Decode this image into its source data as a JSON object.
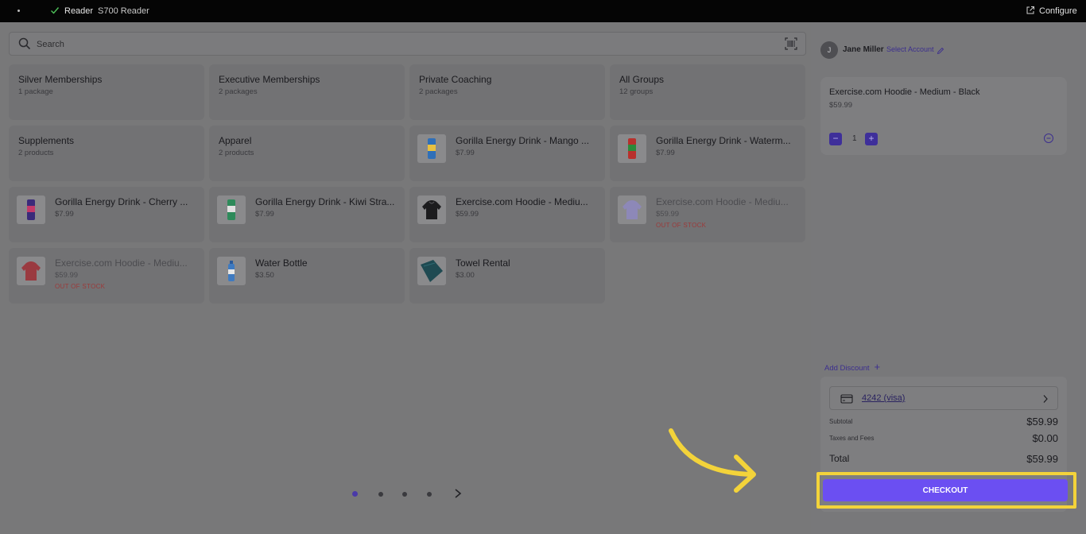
{
  "topbar": {
    "reader_label": "Reader",
    "device_label": "S700 Reader",
    "configure_label": "Configure"
  },
  "search": {
    "placeholder": "Search"
  },
  "categories": [
    {
      "name": "Silver Memberships",
      "sub": "1 package"
    },
    {
      "name": "Executive Memberships",
      "sub": "2 packages"
    },
    {
      "name": "Private Coaching",
      "sub": "2 packages"
    },
    {
      "name": "All Groups",
      "sub": "12 groups"
    },
    {
      "name": "Supplements",
      "sub": "2 products"
    },
    {
      "name": "Apparel",
      "sub": "2 products"
    }
  ],
  "products": [
    {
      "name": "Gorilla Energy Drink - Mango ...",
      "price": "$7.99",
      "thumb": "can-blue",
      "status": ""
    },
    {
      "name": "Gorilla Energy Drink - Waterm...",
      "price": "$7.99",
      "thumb": "can-red",
      "status": ""
    },
    {
      "name": "Gorilla Energy Drink - Cherry ...",
      "price": "$7.99",
      "thumb": "can-purple",
      "status": ""
    },
    {
      "name": "Gorilla Energy Drink - Kiwi Stra...",
      "price": "$7.99",
      "thumb": "can-green",
      "status": ""
    },
    {
      "name": "Exercise.com Hoodie - Mediu...",
      "price": "$59.99",
      "thumb": "hoodie-black",
      "status": ""
    },
    {
      "name": "Exercise.com Hoodie - Mediu...",
      "price": "$59.99",
      "thumb": "hoodie-lavender",
      "status": "OUT OF STOCK"
    },
    {
      "name": "Exercise.com Hoodie - Mediu...",
      "price": "$59.99",
      "thumb": "hoodie-red",
      "status": "OUT OF STOCK"
    },
    {
      "name": "Water Bottle",
      "price": "$3.50",
      "thumb": "bottle",
      "status": ""
    },
    {
      "name": "Towel Rental",
      "price": "$3.00",
      "thumb": "towel",
      "status": ""
    }
  ],
  "pagination": {
    "pages": 4,
    "current": 1
  },
  "cart": {
    "avatar_initial": "J",
    "user_name": "Jane Miller",
    "select_account": "Select Account",
    "item": {
      "name": "Exercise.com Hoodie - Medium - Black",
      "price": "$59.99",
      "quantity": "1"
    },
    "add_discount": "Add Discount",
    "card_label": "4242 (visa)",
    "subtotal_label": "Subtotal",
    "subtotal": "$59.99",
    "taxes_label": "Taxes and Fees",
    "taxes": "$0.00",
    "total_label": "Total",
    "total": "$59.99",
    "checkout_label": "CHECKOUT"
  },
  "colors": {
    "accent": "#6b4ff2",
    "highlight": "#f3d33a",
    "out_of_stock": "#9b3a3a"
  }
}
